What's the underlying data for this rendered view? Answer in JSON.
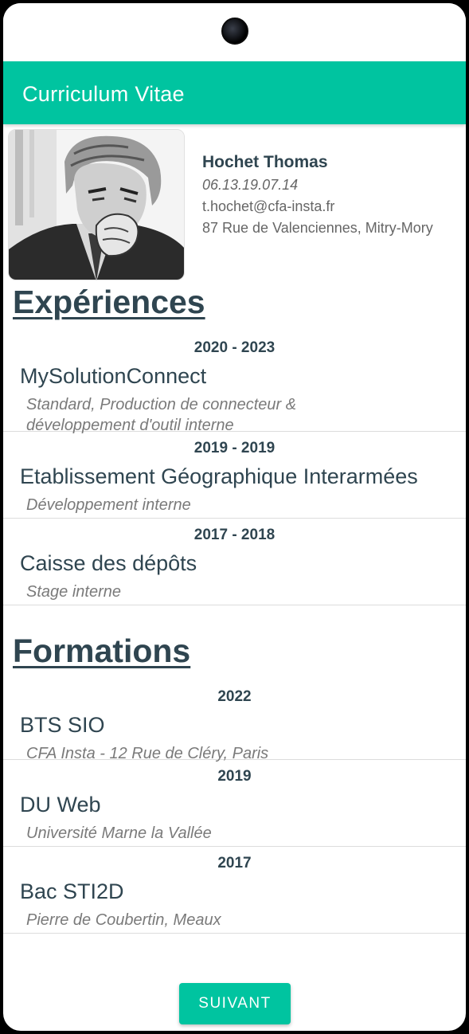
{
  "app": {
    "title": "Curriculum Vitae"
  },
  "profile": {
    "name": "Hochet Thomas",
    "phone": "06.13.19.07.14",
    "email": "t.hochet@cfa-insta.fr",
    "address": "87 Rue de Valenciennes, Mitry-Mory"
  },
  "experiences": {
    "title": "Expériences",
    "items": [
      {
        "years": "2020 - 2023",
        "title": "MySolutionConnect",
        "desc": "Standard, Production de connecteur & développement d'outil interne"
      },
      {
        "years": "2019 - 2019",
        "title": "Etablissement Géographique Interarmées",
        "desc": "Développement interne"
      },
      {
        "years": "2017 - 2018",
        "title": "Caisse des dépôts",
        "desc": "Stage interne"
      }
    ]
  },
  "formations": {
    "title": "Formations",
    "items": [
      {
        "years": "2022",
        "title": "BTS SIO",
        "desc": "CFA Insta - 12 Rue de Cléry, Paris"
      },
      {
        "years": "2019",
        "title": "DU Web",
        "desc": "Université Marne la Vallée"
      },
      {
        "years": "2017",
        "title": "Bac STI2D",
        "desc": "Pierre de Coubertin, Meaux"
      }
    ]
  },
  "actions": {
    "next_label": "SUIVANT"
  },
  "colors": {
    "accent": "#00c4a0",
    "heading": "#2f4550"
  }
}
